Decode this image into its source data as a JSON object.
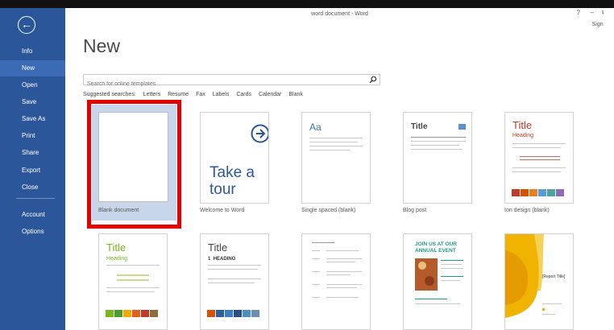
{
  "window": {
    "title": "word document - Word",
    "help": "?",
    "minimize": "–",
    "restore": "⧉",
    "sign_in": "Sign in"
  },
  "backstage": {
    "back_glyph": "←",
    "nav": [
      "Info",
      "New",
      "Open",
      "Save",
      "Save As",
      "Print",
      "Share",
      "Export",
      "Close",
      "Account",
      "Options"
    ],
    "active": "New"
  },
  "main": {
    "heading": "New",
    "search": {
      "placeholder": "Search for online templates",
      "icon": "search-icon"
    },
    "suggested_label": "Suggested searches:",
    "suggested": [
      "Letters",
      "Resume",
      "Fax",
      "Labels",
      "Cards",
      "Calendar",
      "Blank"
    ]
  },
  "templates": {
    "blank": "Blank document",
    "tour_line1": "Take a",
    "tour_line2": "tour",
    "tour_caption": "Welcome to Word",
    "single_aa": "Aa",
    "single_caption": "Single spaced (blank)",
    "blog_title": "Title",
    "blog_caption": "Blog post",
    "ion_title": "Title",
    "ion_heading": "Heading",
    "ion_caption": "Ion design (blank)",
    "r2a_title": "Title",
    "r2a_heading": "Heading",
    "r2b_title": "Title",
    "r2b_num": "1",
    "r2b_heading": "HEADING",
    "r2d_event_line1": "JOIN US AT OUR",
    "r2d_event_line2": "ANNUAL EVENT",
    "r2e_report": "[Report Title]"
  },
  "colors": {
    "sidebar": "#2b579a",
    "highlight": "#e30000",
    "ion_red": "#c0392b",
    "green_title": "#7ab51d",
    "teal_event": "#1f9a8a"
  }
}
